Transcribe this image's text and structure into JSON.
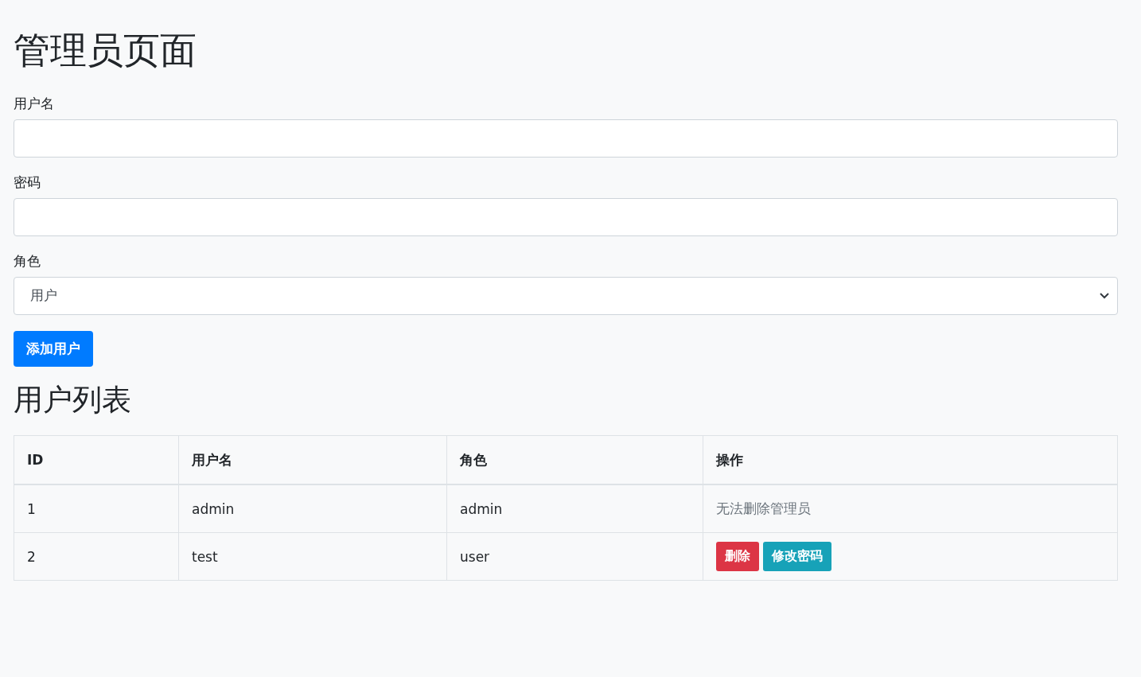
{
  "title": "管理员页面",
  "form": {
    "fields": [
      {
        "kind": "text",
        "label": "用户名"
      },
      {
        "kind": "password",
        "label": "密码"
      },
      {
        "kind": "select",
        "label": "角色",
        "value": "用户"
      }
    ],
    "submit": "添加用户"
  },
  "list_title": "用户列表",
  "table": {
    "columns": [
      "ID",
      "用户名",
      "角色",
      "操作"
    ],
    "rows": [
      {
        "cells": [
          "1",
          "admin",
          "admin"
        ],
        "action": {
          "kind": "note",
          "text": "无法删除管理员"
        }
      },
      {
        "cells": [
          "2",
          "test",
          "user"
        ],
        "action": {
          "kind": "buttons",
          "buttons": [
            {
              "kind": "danger",
              "label": "删除"
            },
            {
              "kind": "info",
              "label": "修改密码"
            }
          ]
        }
      }
    ]
  }
}
